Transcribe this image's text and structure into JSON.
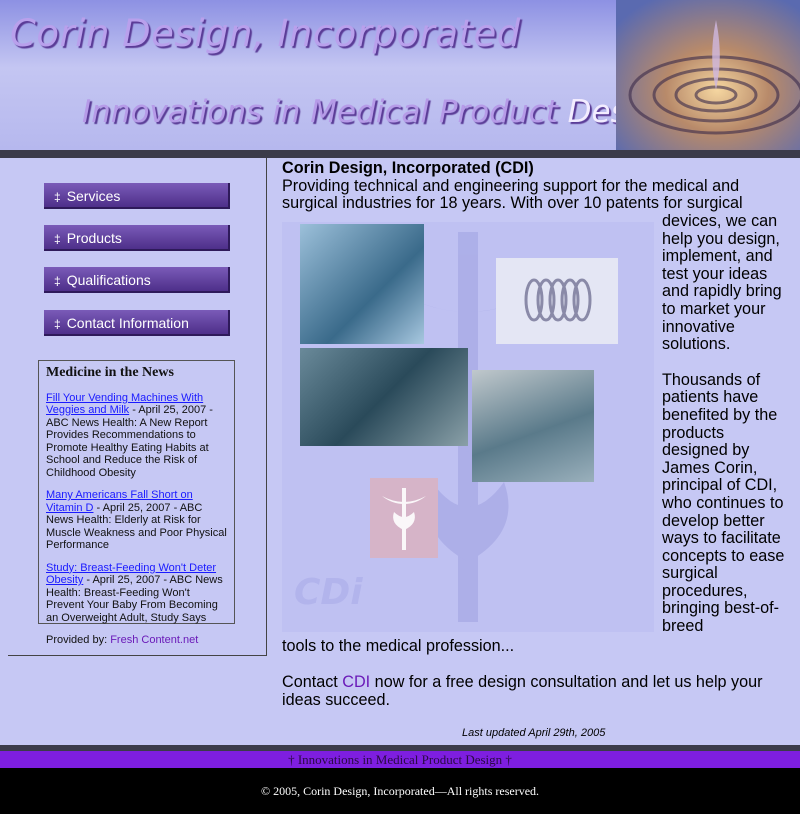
{
  "header": {
    "title": "Corin Design, Incorporated",
    "tagline": "Innovations in Medical Product",
    "tagline_last": "Design"
  },
  "nav": [
    {
      "mark": "‡",
      "label": "Services"
    },
    {
      "mark": "‡",
      "label": "Products"
    },
    {
      "mark": "‡",
      "label": "Qualifications"
    },
    {
      "mark": "‡",
      "label": "Contact Information"
    }
  ],
  "news": {
    "heading": "Medicine in the News",
    "items": [
      {
        "link": "Fill Your Vending Machines With Veggies and Milk",
        "text": " - April 25, 2007 - ABC News Health: A New Report Provides Recommendations to Promote Healthy Eating Habits at School and Reduce the Risk of Childhood Obesity"
      },
      {
        "link": "Many Americans Fall Short on Vitamin D",
        "text": " - April 25, 2007 - ABC News Health: Elderly at Risk for Muscle Weakness and Poor Physical Performance"
      },
      {
        "link": "Study: Breast-Feeding Won't Deter Obesity",
        "text": " - April 25, 2007 - ABC News Health: Breast-Feeding Won't Prevent Your Baby From Becoming an Overweight Adult, Study Says"
      }
    ],
    "provided_label": "Provided by: ",
    "provided_link": "Fresh Content.net"
  },
  "main": {
    "heading": "Corin Design, Incorporated (CDI)",
    "intro": "Providing technical and engineering support for the medical and surgical industries for 18 years. With over 10 patents for surgical",
    "side_p1": "devices, we can help you design, implement, and test your ideas and rapidly bring to market your innovative solutions.",
    "side_p2": "Thousands of patients have benefited by the products designed by James Corin, principal of CDI, who continues to develop better ways to facilitate concepts to ease surgical procedures, bringing best-of-breed",
    "tail": "tools to the medical profession...",
    "contact_pre": "Contact ",
    "contact_link": "CDI",
    "contact_post": " now for a free design consultation and let us help your ideas succeed.",
    "collage_logo": "CDi",
    "updated": "Last updated April 29th, 2005"
  },
  "footer": {
    "tagline": "† Innovations in Medical Product Design †",
    "copyright": "© 2005, Corin Design, Incorporated—All rights reserved."
  }
}
